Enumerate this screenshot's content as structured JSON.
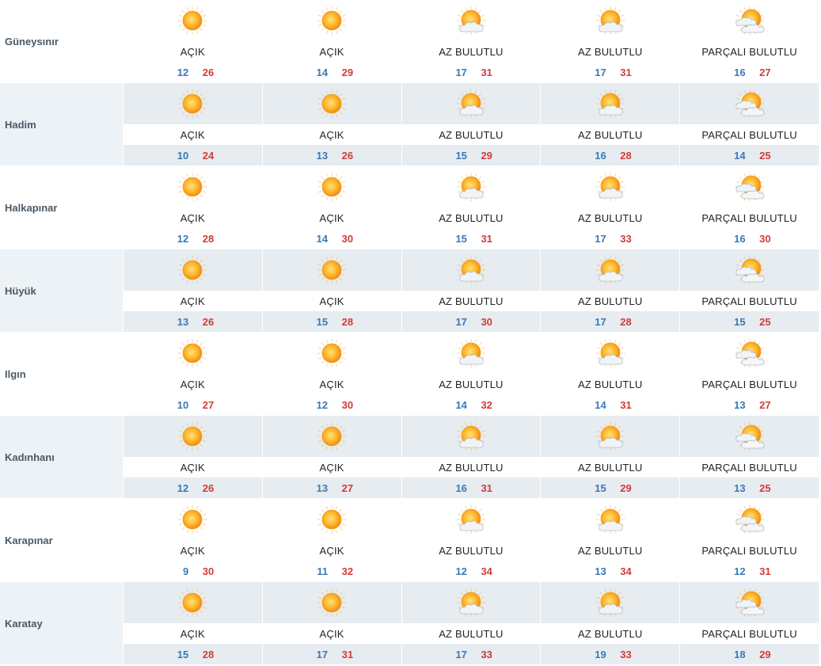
{
  "colors": {
    "min_temp": "#3a78b8",
    "max_temp": "#d23b36",
    "city_label": "#4a5a66",
    "row_shade": "#e6ecf0"
  },
  "rows": [
    {
      "city": "Güneysınır",
      "days": [
        {
          "icon": "sun-icon",
          "condition": "AÇIK",
          "min": "12",
          "max": "26"
        },
        {
          "icon": "sun-icon",
          "condition": "AÇIK",
          "min": "14",
          "max": "29"
        },
        {
          "icon": "sun-cloud-icon",
          "condition": "AZ BULUTLU",
          "min": "17",
          "max": "31"
        },
        {
          "icon": "sun-cloud-icon",
          "condition": "AZ BULUTLU",
          "min": "17",
          "max": "31"
        },
        {
          "icon": "partly-cloudy-icon",
          "condition": "PARÇALI BULUTLU",
          "min": "16",
          "max": "27"
        }
      ]
    },
    {
      "city": "Hadim",
      "days": [
        {
          "icon": "sun-icon",
          "condition": "AÇIK",
          "min": "10",
          "max": "24"
        },
        {
          "icon": "sun-icon",
          "condition": "AÇIK",
          "min": "13",
          "max": "26"
        },
        {
          "icon": "sun-cloud-icon",
          "condition": "AZ BULUTLU",
          "min": "15",
          "max": "29"
        },
        {
          "icon": "sun-cloud-icon",
          "condition": "AZ BULUTLU",
          "min": "16",
          "max": "28"
        },
        {
          "icon": "partly-cloudy-icon",
          "condition": "PARÇALI BULUTLU",
          "min": "14",
          "max": "25"
        }
      ]
    },
    {
      "city": "Halkapınar",
      "days": [
        {
          "icon": "sun-icon",
          "condition": "AÇIK",
          "min": "12",
          "max": "28"
        },
        {
          "icon": "sun-icon",
          "condition": "AÇIK",
          "min": "14",
          "max": "30"
        },
        {
          "icon": "sun-cloud-icon",
          "condition": "AZ BULUTLU",
          "min": "15",
          "max": "31"
        },
        {
          "icon": "sun-cloud-icon",
          "condition": "AZ BULUTLU",
          "min": "17",
          "max": "33"
        },
        {
          "icon": "partly-cloudy-icon",
          "condition": "PARÇALI BULUTLU",
          "min": "16",
          "max": "30"
        }
      ]
    },
    {
      "city": "Hüyük",
      "days": [
        {
          "icon": "sun-icon",
          "condition": "AÇIK",
          "min": "13",
          "max": "26"
        },
        {
          "icon": "sun-icon",
          "condition": "AÇIK",
          "min": "15",
          "max": "28"
        },
        {
          "icon": "sun-cloud-icon",
          "condition": "AZ BULUTLU",
          "min": "17",
          "max": "30"
        },
        {
          "icon": "sun-cloud-icon",
          "condition": "AZ BULUTLU",
          "min": "17",
          "max": "28"
        },
        {
          "icon": "partly-cloudy-icon",
          "condition": "PARÇALI BULUTLU",
          "min": "15",
          "max": "25"
        }
      ]
    },
    {
      "city": "Ilgın",
      "days": [
        {
          "icon": "sun-icon",
          "condition": "AÇIK",
          "min": "10",
          "max": "27"
        },
        {
          "icon": "sun-icon",
          "condition": "AÇIK",
          "min": "12",
          "max": "30"
        },
        {
          "icon": "sun-cloud-icon",
          "condition": "AZ BULUTLU",
          "min": "14",
          "max": "32"
        },
        {
          "icon": "sun-cloud-icon",
          "condition": "AZ BULUTLU",
          "min": "14",
          "max": "31"
        },
        {
          "icon": "partly-cloudy-icon",
          "condition": "PARÇALI BULUTLU",
          "min": "13",
          "max": "27"
        }
      ]
    },
    {
      "city": "Kadınhanı",
      "days": [
        {
          "icon": "sun-icon",
          "condition": "AÇIK",
          "min": "12",
          "max": "26"
        },
        {
          "icon": "sun-icon",
          "condition": "AÇIK",
          "min": "13",
          "max": "27"
        },
        {
          "icon": "sun-cloud-icon",
          "condition": "AZ BULUTLU",
          "min": "16",
          "max": "31"
        },
        {
          "icon": "sun-cloud-icon",
          "condition": "AZ BULUTLU",
          "min": "15",
          "max": "29"
        },
        {
          "icon": "partly-cloudy-icon",
          "condition": "PARÇALI BULUTLU",
          "min": "13",
          "max": "25"
        }
      ]
    },
    {
      "city": "Karapınar",
      "days": [
        {
          "icon": "sun-icon",
          "condition": "AÇIK",
          "min": "9",
          "max": "30"
        },
        {
          "icon": "sun-icon",
          "condition": "AÇIK",
          "min": "11",
          "max": "32"
        },
        {
          "icon": "sun-cloud-icon",
          "condition": "AZ BULUTLU",
          "min": "12",
          "max": "34"
        },
        {
          "icon": "sun-cloud-icon",
          "condition": "AZ BULUTLU",
          "min": "13",
          "max": "34"
        },
        {
          "icon": "partly-cloudy-icon",
          "condition": "PARÇALI BULUTLU",
          "min": "12",
          "max": "31"
        }
      ]
    },
    {
      "city": "Karatay",
      "days": [
        {
          "icon": "sun-icon",
          "condition": "AÇIK",
          "min": "15",
          "max": "28"
        },
        {
          "icon": "sun-icon",
          "condition": "AÇIK",
          "min": "17",
          "max": "31"
        },
        {
          "icon": "sun-cloud-icon",
          "condition": "AZ BULUTLU",
          "min": "17",
          "max": "33"
        },
        {
          "icon": "sun-cloud-icon",
          "condition": "AZ BULUTLU",
          "min": "19",
          "max": "33"
        },
        {
          "icon": "partly-cloudy-icon",
          "condition": "PARÇALI BULUTLU",
          "min": "18",
          "max": "29"
        }
      ]
    }
  ]
}
